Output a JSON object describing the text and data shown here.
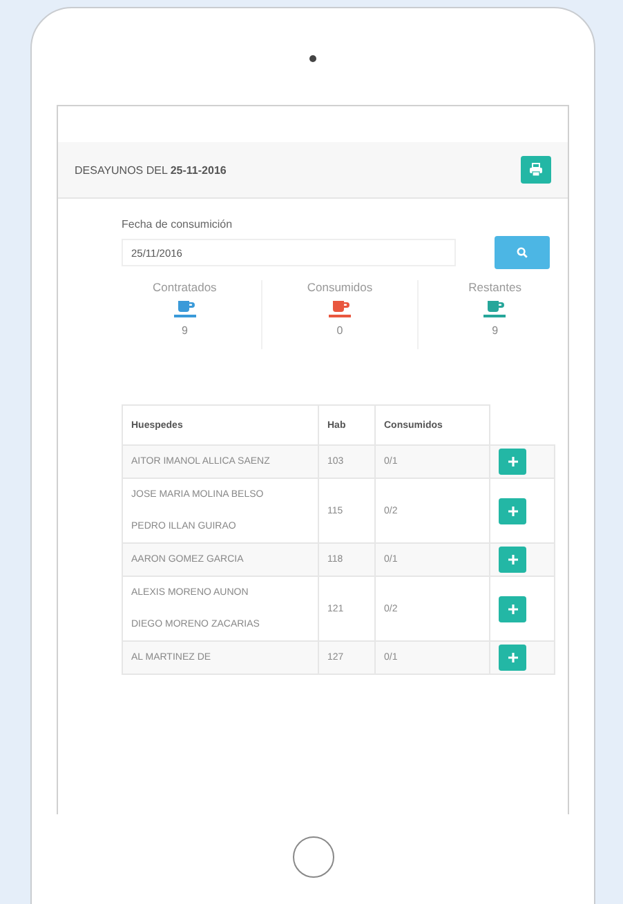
{
  "header": {
    "title": "DESAYUNOS DEL **25-11-2016**"
  },
  "form": {
    "label": "Fecha de consumición",
    "value": "25/11/2016"
  },
  "stats": [
    {
      "label": "Contratados",
      "value": "9",
      "color": "#3a9ad9"
    },
    {
      "label": "Consumidos",
      "value": "0",
      "color": "#e9573f"
    },
    {
      "label": "Restantes",
      "value": "9",
      "color": "#26a69a"
    }
  ],
  "table": {
    "columns": [
      "Huespedes",
      "Hab",
      "Consumidos"
    ],
    "rows": [
      {
        "guests": [
          "AITOR IMANOL ALLICA SAENZ"
        ],
        "hab": "103",
        "consumidos": "0/1"
      },
      {
        "guests": [
          "JOSE MARIA MOLINA BELSO",
          "PEDRO ILLAN GUIRAO"
        ],
        "hab": "115",
        "consumidos": "0/2"
      },
      {
        "guests": [
          "AARON GOMEZ GARCIA"
        ],
        "hab": "118",
        "consumidos": "0/1"
      },
      {
        "guests": [
          "ALEXIS MORENO AUNON",
          "DIEGO MORENO ZACARIAS"
        ],
        "hab": "121",
        "consumidos": "0/2"
      },
      {
        "guests": [
          "AL MARTINEZ DE"
        ],
        "hab": "127",
        "consumidos": "0/1"
      }
    ]
  }
}
